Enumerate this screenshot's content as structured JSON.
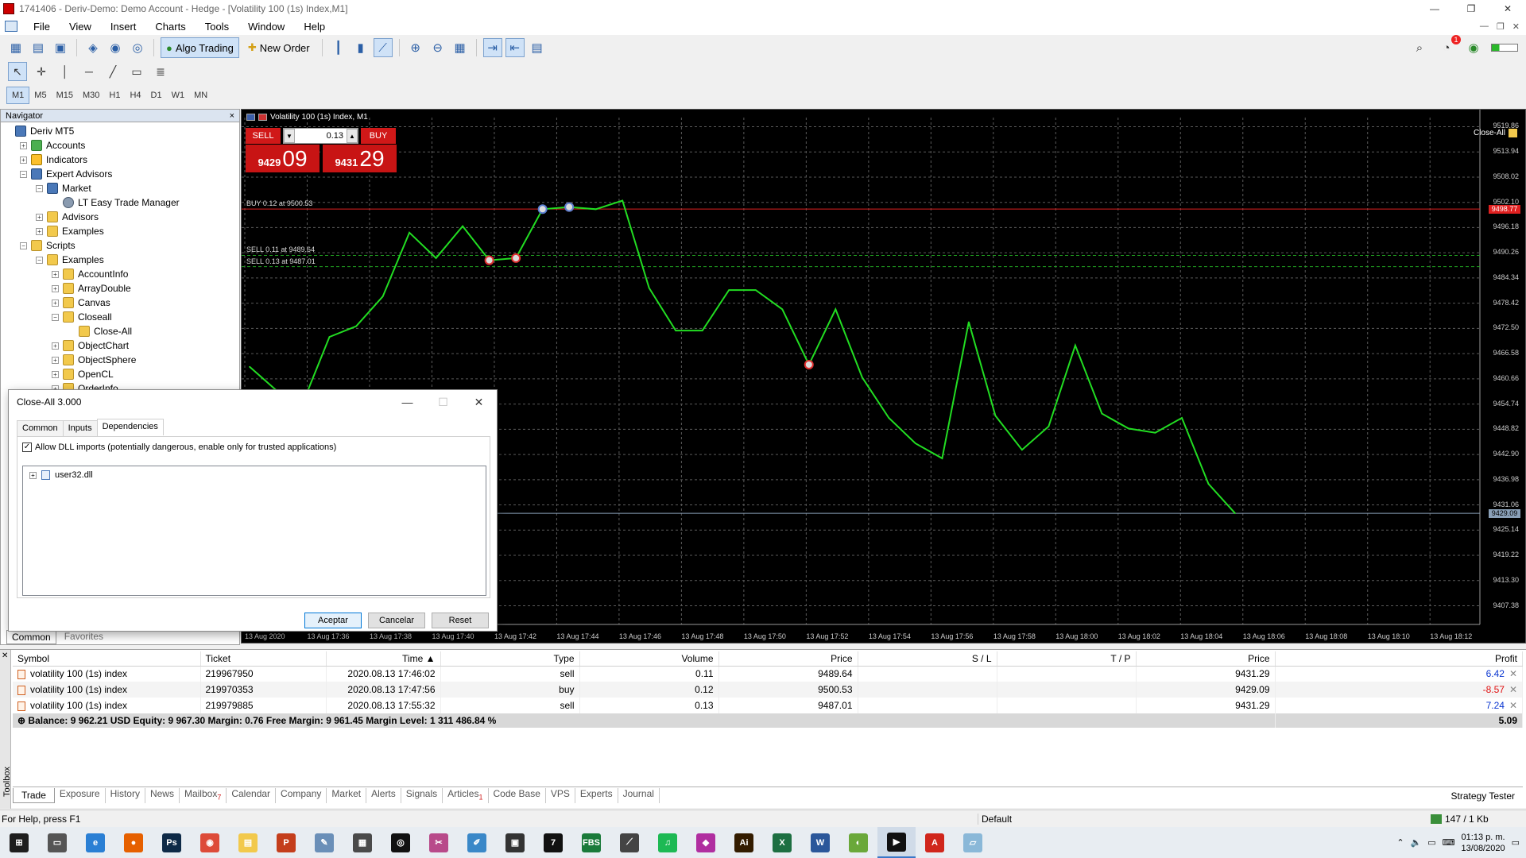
{
  "window": {
    "title": "1741406 - Deriv-Demo: Demo Account - Hedge - [Volatility 100 (1s) Index,M1]",
    "controls": [
      "—",
      "❐",
      "✕"
    ]
  },
  "menu": [
    "File",
    "View",
    "Insert",
    "Charts",
    "Tools",
    "Window",
    "Help"
  ],
  "toolbar": {
    "algo_trading": "Algo Trading",
    "new_order": "New Order",
    "notifications_count": "1"
  },
  "timeframes": [
    "M1",
    "M5",
    "M15",
    "M30",
    "H1",
    "H4",
    "D1",
    "W1",
    "MN"
  ],
  "timeframe_active": "M1",
  "navigator": {
    "title": "Navigator",
    "close": "×",
    "tree": [
      {
        "label": "Deriv MT5",
        "icon": "terminal-icon",
        "level": 0,
        "exp": ""
      },
      {
        "label": "Accounts",
        "icon": "accounts-icon",
        "level": 1,
        "exp": "+"
      },
      {
        "label": "Indicators",
        "icon": "indicators-icon",
        "level": 1,
        "exp": "+"
      },
      {
        "label": "Expert Advisors",
        "icon": "experts-icon",
        "level": 1,
        "exp": "−"
      },
      {
        "label": "Market",
        "icon": "market-icon",
        "level": 2,
        "exp": "−"
      },
      {
        "label": "LT Easy Trade Manager",
        "icon": "expert-icon",
        "level": 3,
        "exp": ""
      },
      {
        "label": "Advisors",
        "icon": "folder-icon",
        "level": 2,
        "exp": "+"
      },
      {
        "label": "Examples",
        "icon": "folder-icon",
        "level": 2,
        "exp": "+"
      },
      {
        "label": "Scripts",
        "icon": "scripts-icon",
        "level": 1,
        "exp": "−"
      },
      {
        "label": "Examples",
        "icon": "folder-icon",
        "level": 2,
        "exp": "−"
      },
      {
        "label": "AccountInfo",
        "icon": "folder-icon",
        "level": 3,
        "exp": "+"
      },
      {
        "label": "ArrayDouble",
        "icon": "folder-icon",
        "level": 3,
        "exp": "+"
      },
      {
        "label": "Canvas",
        "icon": "folder-icon",
        "level": 3,
        "exp": "+"
      },
      {
        "label": "Closeall",
        "icon": "folder-icon",
        "level": 3,
        "exp": "−"
      },
      {
        "label": "Close-All",
        "icon": "script-icon",
        "level": 4,
        "exp": ""
      },
      {
        "label": "ObjectChart",
        "icon": "folder-icon",
        "level": 3,
        "exp": "+"
      },
      {
        "label": "ObjectSphere",
        "icon": "folder-icon",
        "level": 3,
        "exp": "+"
      },
      {
        "label": "OpenCL",
        "icon": "folder-icon",
        "level": 3,
        "exp": "+"
      },
      {
        "label": "OrderInfo",
        "icon": "folder-icon",
        "level": 3,
        "exp": "+"
      }
    ],
    "bottom_tabs": [
      "Common",
      "Favorites"
    ]
  },
  "chart": {
    "symbol_title": "Volatility 100 (1s) Index, M1",
    "sell_label": "SELL",
    "buy_label": "BUY",
    "volume": "0.13",
    "sell_price_small": "9429",
    "sell_price_big": "09",
    "buy_price_small": "9431",
    "buy_price_big": "29",
    "close_all_label": "Close-All",
    "trade_lines": [
      {
        "label": "BUY 0.12 at 9500.53",
        "price": 9500.53,
        "color": "#e02020"
      },
      {
        "label": "SELL 0.11 at 9489.64",
        "price": 9489.64,
        "color": "#20a020"
      },
      {
        "label": "SELL 0.13 at 9487.01",
        "price": 9487.01,
        "color": "#20a020"
      }
    ],
    "current_price_tag": "9429.09",
    "buy_price_tag": "9498.77",
    "line_color": "#22dd22"
  },
  "chart_data": {
    "type": "line",
    "title": "Volatility 100 (1s) Index, M1",
    "ylim": [
      9403.0,
      9522.0
    ],
    "y_ticks": [
      "9519.86",
      "9513.94",
      "9508.02",
      "9502.10",
      "9496.18",
      "9490.26",
      "9484.34",
      "9478.42",
      "9472.50",
      "9466.58",
      "9460.66",
      "9454.74",
      "9448.82",
      "9442.90",
      "9436.98",
      "9431.06",
      "9425.14",
      "9419.22",
      "9413.30",
      "9407.38"
    ],
    "x_ticks": [
      "13 Aug 2020",
      "13 Aug 17:36",
      "13 Aug 17:38",
      "13 Aug 17:40",
      "13 Aug 17:42",
      "13 Aug 17:44",
      "13 Aug 17:46",
      "13 Aug 17:48",
      "13 Aug 17:50",
      "13 Aug 17:52",
      "13 Aug 17:54",
      "13 Aug 17:56",
      "13 Aug 17:58",
      "13 Aug 18:00",
      "13 Aug 18:02",
      "13 Aug 18:04",
      "13 Aug 18:06",
      "13 Aug 18:08",
      "13 Aug 18:10",
      "13 Aug 18:12"
    ],
    "series": [
      {
        "values": [
          9463.5,
          9458.0,
          9455.0,
          9470.5,
          9473.0,
          9480.0,
          9495.0,
          9489.0,
          9496.5,
          9488.5,
          9489.0,
          9500.5,
          9501.0,
          9500.5,
          9502.5,
          9482.0,
          9472.0,
          9472.0,
          9481.5,
          9481.5,
          9477.0,
          9464.0,
          9477.0,
          9461.0,
          9451.5,
          9445.5,
          9442.0,
          9474.0,
          9452.0,
          9444.0,
          9449.5,
          9468.5,
          9452.5,
          9449.0,
          9448.0,
          9451.5,
          9436.0,
          9429.1
        ]
      }
    ]
  },
  "dialog": {
    "title": "Close-All 3.000",
    "tabs": [
      "Common",
      "Inputs",
      "Dependencies"
    ],
    "active_tab": "Dependencies",
    "allow_dll_label": "Allow DLL imports (potentially dangerous, enable only for trusted applications)",
    "allow_dll_checked": true,
    "dll_item": "user32.dll",
    "ok": "Aceptar",
    "cancel": "Cancelar",
    "reset": "Reset"
  },
  "trade": {
    "headers": {
      "symbol": "Symbol",
      "ticket": "Ticket",
      "time": "Time",
      "type": "Type",
      "volume": "Volume",
      "price": "Price",
      "sl": "S / L",
      "tp": "T / P",
      "cur_price": "Price",
      "profit": "Profit"
    },
    "rows": [
      {
        "symbol": "volatility 100 (1s) index",
        "ticket": "219967950",
        "time": "2020.08.13 17:46:02",
        "type": "sell",
        "volume": "0.11",
        "price": "9489.64",
        "sl": "",
        "tp": "",
        "cur_price": "9431.29",
        "profit": "6.42"
      },
      {
        "symbol": "volatility 100 (1s) index",
        "ticket": "219970353",
        "time": "2020.08.13 17:47:56",
        "type": "buy",
        "volume": "0.12",
        "price": "9500.53",
        "sl": "",
        "tp": "",
        "cur_price": "9429.09",
        "profit": "-8.57"
      },
      {
        "symbol": "volatility 100 (1s) index",
        "ticket": "219979885",
        "time": "2020.08.13 17:55:32",
        "type": "sell",
        "volume": "0.13",
        "price": "9487.01",
        "sl": "",
        "tp": "",
        "cur_price": "9431.29",
        "profit": "7.24"
      }
    ],
    "summary": "Balance: 9 962.21 USD  Equity: 9 967.30  Margin: 0.76  Free Margin: 9 961.45  Margin Level: 1 311 486.84 %",
    "total_profit": "5.09"
  },
  "toolbox": {
    "title": "Toolbox",
    "tabs": [
      {
        "label": "Trade",
        "badge": ""
      },
      {
        "label": "Exposure",
        "badge": ""
      },
      {
        "label": "History",
        "badge": ""
      },
      {
        "label": "News",
        "badge": ""
      },
      {
        "label": "Mailbox",
        "badge": "7"
      },
      {
        "label": "Calendar",
        "badge": ""
      },
      {
        "label": "Company",
        "badge": ""
      },
      {
        "label": "Market",
        "badge": ""
      },
      {
        "label": "Alerts",
        "badge": ""
      },
      {
        "label": "Signals",
        "badge": ""
      },
      {
        "label": "Articles",
        "badge": "1"
      },
      {
        "label": "Code Base",
        "badge": ""
      },
      {
        "label": "VPS",
        "badge": ""
      },
      {
        "label": "Experts",
        "badge": ""
      },
      {
        "label": "Journal",
        "badge": ""
      }
    ],
    "active_tab": "Trade",
    "strategy_tester": "Strategy Tester"
  },
  "status": {
    "help": "For Help, press F1",
    "profile": "Default",
    "connection": "147 / 1 Kb"
  },
  "taskbar": {
    "time": "01:13 p. m.",
    "date": "13/08/2020",
    "apps": [
      {
        "name": "windows-start-icon",
        "color": "#1e1e1e",
        "glyph": "⊞"
      },
      {
        "name": "task-view-icon",
        "color": "#555",
        "glyph": "▭"
      },
      {
        "name": "edge-icon",
        "color": "#2a7fd4",
        "glyph": "e"
      },
      {
        "name": "firefox-icon",
        "color": "#e66000",
        "glyph": "●"
      },
      {
        "name": "photoshop-icon",
        "color": "#0e2a47",
        "glyph": "Ps"
      },
      {
        "name": "chrome-icon",
        "color": "#dd4b39",
        "glyph": "◉"
      },
      {
        "name": "file-explorer-icon",
        "color": "#f2c94c",
        "glyph": "▤"
      },
      {
        "name": "powerpoint-icon",
        "color": "#c43e1c",
        "glyph": "P"
      },
      {
        "name": "feather-icon",
        "color": "#6a8fb8",
        "glyph": "✎"
      },
      {
        "name": "calculator-icon",
        "color": "#4a4a4a",
        "glyph": "▦"
      },
      {
        "name": "maps-icon",
        "color": "#111",
        "glyph": "◎"
      },
      {
        "name": "tool-icon",
        "color": "#b84a8a",
        "glyph": "✂"
      },
      {
        "name": "brush-icon",
        "color": "#3a88c8",
        "glyph": "✐"
      },
      {
        "name": "sticky-icon",
        "color": "#333",
        "glyph": "▣"
      },
      {
        "name": "seven-icon",
        "color": "#111",
        "glyph": "7"
      },
      {
        "name": "fbs-icon",
        "color": "#1a7a3a",
        "glyph": "FBS"
      },
      {
        "name": "code-icon",
        "color": "#444",
        "glyph": "⟋"
      },
      {
        "name": "spotify-icon",
        "color": "#1db954",
        "glyph": "♫"
      },
      {
        "name": "app-purple-icon",
        "color": "#b02ea0",
        "glyph": "◆"
      },
      {
        "name": "illustrator-icon",
        "color": "#331c00",
        "glyph": "Ai"
      },
      {
        "name": "excel-icon",
        "color": "#1d6f42",
        "glyph": "X"
      },
      {
        "name": "word-icon",
        "color": "#2b579a",
        "glyph": "W"
      },
      {
        "name": "android-icon",
        "color": "#6aa83a",
        "glyph": "◐"
      },
      {
        "name": "metatrader-icon",
        "color": "#111",
        "glyph": "▶"
      },
      {
        "name": "acrobat-icon",
        "color": "#d0261c",
        "glyph": "A"
      },
      {
        "name": "notes-icon",
        "color": "#8ab8d8",
        "glyph": "▱"
      }
    ]
  }
}
